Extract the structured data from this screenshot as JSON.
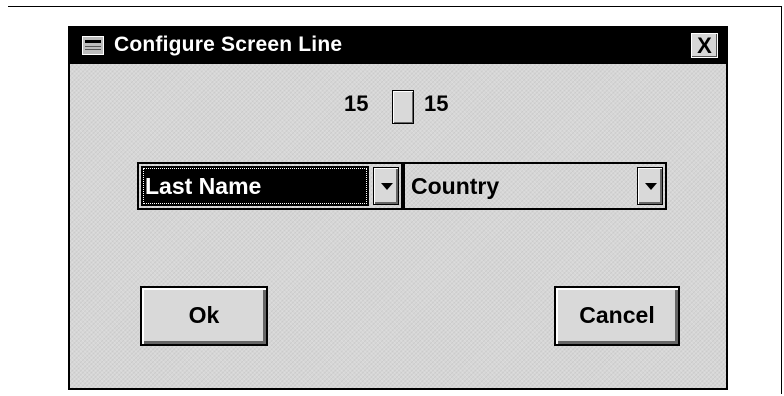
{
  "dialog": {
    "title": "Configure Screen Line",
    "close_label": "X",
    "range": {
      "left_value": "15",
      "right_value": "15"
    },
    "fields": [
      {
        "label": "Last Name"
      },
      {
        "label": "Country"
      }
    ],
    "ok_label": "Ok",
    "cancel_label": "Cancel"
  }
}
